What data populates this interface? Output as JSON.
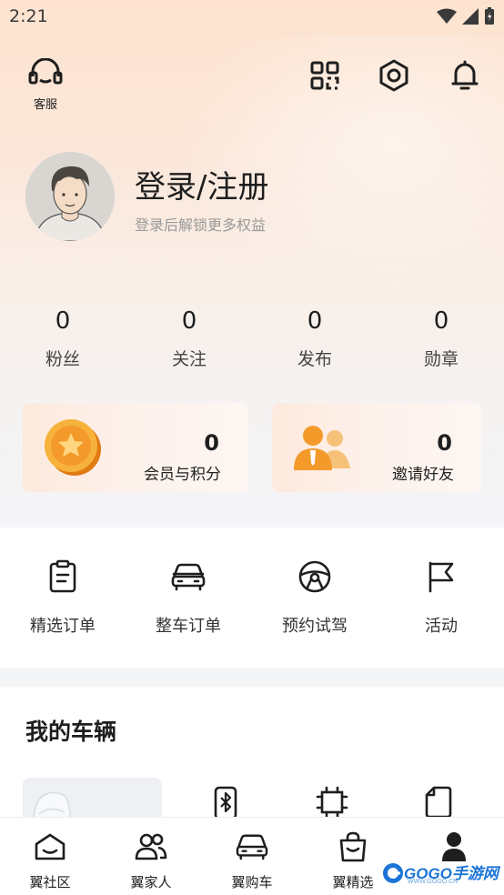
{
  "status_bar": {
    "time": "2:21"
  },
  "header": {
    "service_label": "客服",
    "icons": [
      "qr-code-icon",
      "settings-icon",
      "bell-icon"
    ]
  },
  "profile": {
    "title": "登录/注册",
    "subtitle": "登录后解锁更多权益"
  },
  "stats": [
    {
      "value": "0",
      "label": "粉丝"
    },
    {
      "value": "0",
      "label": "关注"
    },
    {
      "value": "0",
      "label": "发布"
    },
    {
      "value": "0",
      "label": "勋章"
    }
  ],
  "cards": {
    "points": {
      "value": "0",
      "label": "会员与积分",
      "icon": "coin-star-icon"
    },
    "invite": {
      "value": "0",
      "label": "邀请好友",
      "icon": "friends-icon"
    }
  },
  "quick_actions": [
    {
      "label": "精选订单",
      "icon": "clipboard-icon"
    },
    {
      "label": "整车订单",
      "icon": "car-icon"
    },
    {
      "label": "预约试驾",
      "icon": "steering-wheel-icon"
    },
    {
      "label": "活动",
      "icon": "flag-icon"
    }
  ],
  "vehicles": {
    "title": "我的车辆",
    "icons": [
      "bluetooth-key-icon",
      "chip-icon",
      "document-icon"
    ]
  },
  "tabbar": [
    {
      "label": "翼社区",
      "icon": "community-icon"
    },
    {
      "label": "翼家人",
      "icon": "people-icon"
    },
    {
      "label": "翼购车",
      "icon": "car-icon"
    },
    {
      "label": "翼精选",
      "icon": "shopping-bag-icon"
    },
    {
      "label": "",
      "icon": "profile-icon"
    }
  ],
  "watermark": {
    "text": "GOGO手游网",
    "sub": "WWW.GOGO.CN"
  },
  "colors": {
    "accent_orange": "#f39a2b",
    "text_dark": "#1e1e1e",
    "text_muted": "#9a9a9a"
  }
}
